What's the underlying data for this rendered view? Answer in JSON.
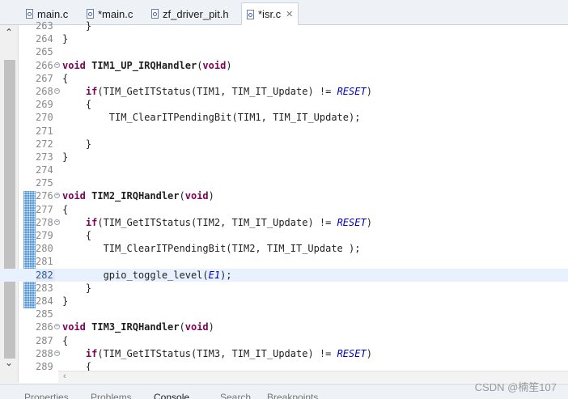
{
  "tabs": [
    {
      "label": "main.c",
      "icon": "c-file-icon",
      "active": false
    },
    {
      "label": "*main.c",
      "icon": "c-file-icon",
      "active": false
    },
    {
      "label": "zf_driver_pit.h",
      "icon": "h-file-icon",
      "active": false
    },
    {
      "label": "*isr.c",
      "icon": "c-file-icon",
      "active": true,
      "close": "✕"
    }
  ],
  "scrollbar": {
    "up": "⌃",
    "down": "⌄"
  },
  "lines": [
    {
      "n": "263",
      "code": "    }"
    },
    {
      "n": "264",
      "code": "}"
    },
    {
      "n": "265",
      "code": ""
    },
    {
      "n": "266",
      "fold": true,
      "code": "void TIM1_UP_IRQHandler(void)"
    },
    {
      "n": "267",
      "code": "{"
    },
    {
      "n": "268",
      "fold": true,
      "code": "    if(TIM_GetITStatus(TIM1, TIM_IT_Update) != RESET)"
    },
    {
      "n": "269",
      "code": "    {"
    },
    {
      "n": "270",
      "code": "        TIM_ClearITPendingBit(TIM1, TIM_IT_Update);"
    },
    {
      "n": "271",
      "code": ""
    },
    {
      "n": "272",
      "code": "    }"
    },
    {
      "n": "273",
      "code": "}"
    },
    {
      "n": "274",
      "code": ""
    },
    {
      "n": "275",
      "code": ""
    },
    {
      "n": "276",
      "fold": true,
      "code": "void TIM2_IRQHandler(void)"
    },
    {
      "n": "277",
      "code": "{"
    },
    {
      "n": "278",
      "fold": true,
      "code": "    if(TIM_GetITStatus(TIM2, TIM_IT_Update) != RESET)"
    },
    {
      "n": "279",
      "code": "    {"
    },
    {
      "n": "280",
      "code": "       TIM_ClearITPendingBit(TIM2, TIM_IT_Update );"
    },
    {
      "n": "281",
      "code": ""
    },
    {
      "n": "282",
      "current": true,
      "code": "       gpio_toggle_level(E1);"
    },
    {
      "n": "283",
      "code": "    }"
    },
    {
      "n": "284",
      "code": "}"
    },
    {
      "n": "285",
      "code": ""
    },
    {
      "n": "286",
      "fold": true,
      "code": "void TIM3_IRQHandler(void)"
    },
    {
      "n": "287",
      "code": "{"
    },
    {
      "n": "288",
      "fold": true,
      "code": "    if(TIM_GetITStatus(TIM3, TIM_IT_Update) != RESET)"
    },
    {
      "n": "289",
      "code": "    {"
    }
  ],
  "bottom_tabs": [
    "Properties",
    "Problems",
    "Console",
    "Search",
    "Breakpoints"
  ],
  "active_bottom_tab": "Console",
  "watermark": "CSDN @楠笙107",
  "colors": {
    "keyword": "#7f0055",
    "constant": "#0000c0",
    "marker": "#5a9ad9",
    "current_line": "#e8f2fe"
  }
}
